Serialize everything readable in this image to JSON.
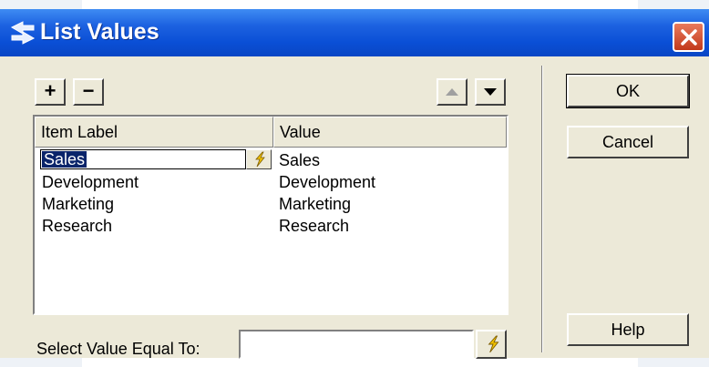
{
  "window": {
    "title": "List Values",
    "title_icon": "list-values-icon",
    "close_icon": "close-icon"
  },
  "toolbar": {
    "add_label": "+",
    "remove_label": "−",
    "move_up_icon": "triangle-up-icon",
    "move_down_icon": "triangle-down-icon"
  },
  "list": {
    "columns": [
      "Item Label",
      "Value"
    ],
    "editing_value": "Sales",
    "rows": [
      {
        "label": "Sales",
        "value": "Sales"
      },
      {
        "label": "Development",
        "value": "Development"
      },
      {
        "label": "Marketing",
        "value": "Marketing"
      },
      {
        "label": "Research",
        "value": "Research"
      }
    ],
    "edit_button_icon": "lightning-bolt-icon"
  },
  "select": {
    "label": "Select Value Equal To:",
    "value": "",
    "button_icon": "lightning-bolt-icon"
  },
  "buttons": {
    "ok": "OK",
    "cancel": "Cancel",
    "help": "Help"
  },
  "colors": {
    "titlebar": "#0a4fd6",
    "dialog_face": "#ece9d8",
    "selection": "#0a246a",
    "close": "#c2391b"
  }
}
